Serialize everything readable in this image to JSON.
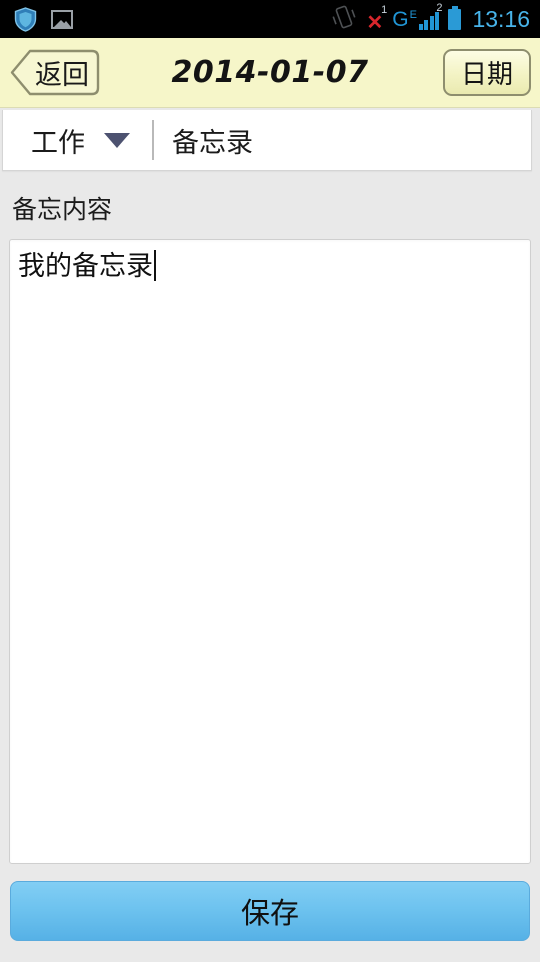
{
  "status_bar": {
    "icons_left": [
      {
        "name": "shield-icon",
        "label": "shield"
      },
      {
        "name": "photo-icon",
        "label": "photo"
      }
    ],
    "icons_right": [
      {
        "name": "vibrate-icon",
        "label": "vibrate"
      },
      {
        "name": "missed-call-icon",
        "label": "missed call"
      }
    ],
    "missed_call_count": "1",
    "network_type": "G",
    "network_tech": "E",
    "sim_slot": "2",
    "battery": "battery-icon",
    "time": "13:16",
    "colors": {
      "background": "#000000",
      "accent": "#2196d6",
      "clock": "#48b4ea",
      "missed": "#d8262c"
    }
  },
  "title_bar": {
    "back_label": "返回",
    "title": "2014-01-07",
    "date_label": "日期",
    "background": "#f6f6c9"
  },
  "category_row": {
    "category": "工作",
    "caret_icon": "chevron-down-icon",
    "kind": "备忘录"
  },
  "memo": {
    "field_label": "备忘内容",
    "content": "我的备忘录",
    "placeholder": ""
  },
  "footer": {
    "save_label": "保存",
    "save_color": "#6ec3ef"
  }
}
